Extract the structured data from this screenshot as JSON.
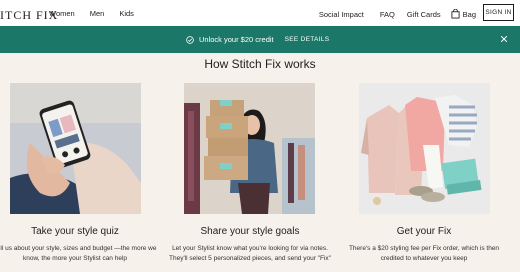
{
  "nav": {
    "logo": "ITCH FIX",
    "left_links": [
      "Women",
      "Men",
      "Kids"
    ],
    "social": "Social Impact",
    "faq": "FAQ",
    "gift": "Gift Cards",
    "bag": "Bag",
    "signin": "SIGN IN"
  },
  "banner": {
    "text": "Unlock your $20 credit",
    "cta": "SEE DETAILS",
    "color": "#1b7768"
  },
  "section_title": "How Stitch Fix works",
  "steps": [
    {
      "title": "Take your style quiz",
      "desc": "Tell us about your style, sizes and budget —the more we know, the more your Stylist can help"
    },
    {
      "title": "Share your style goals",
      "desc": "Let your Stylist know what you're looking for via notes. They'll select 5 personalized pieces, and send your \"Fix\""
    },
    {
      "title": "Get your Fix",
      "desc": "There's a $20 styling fee per Fix order, which is then credited to whatever you keep"
    }
  ]
}
